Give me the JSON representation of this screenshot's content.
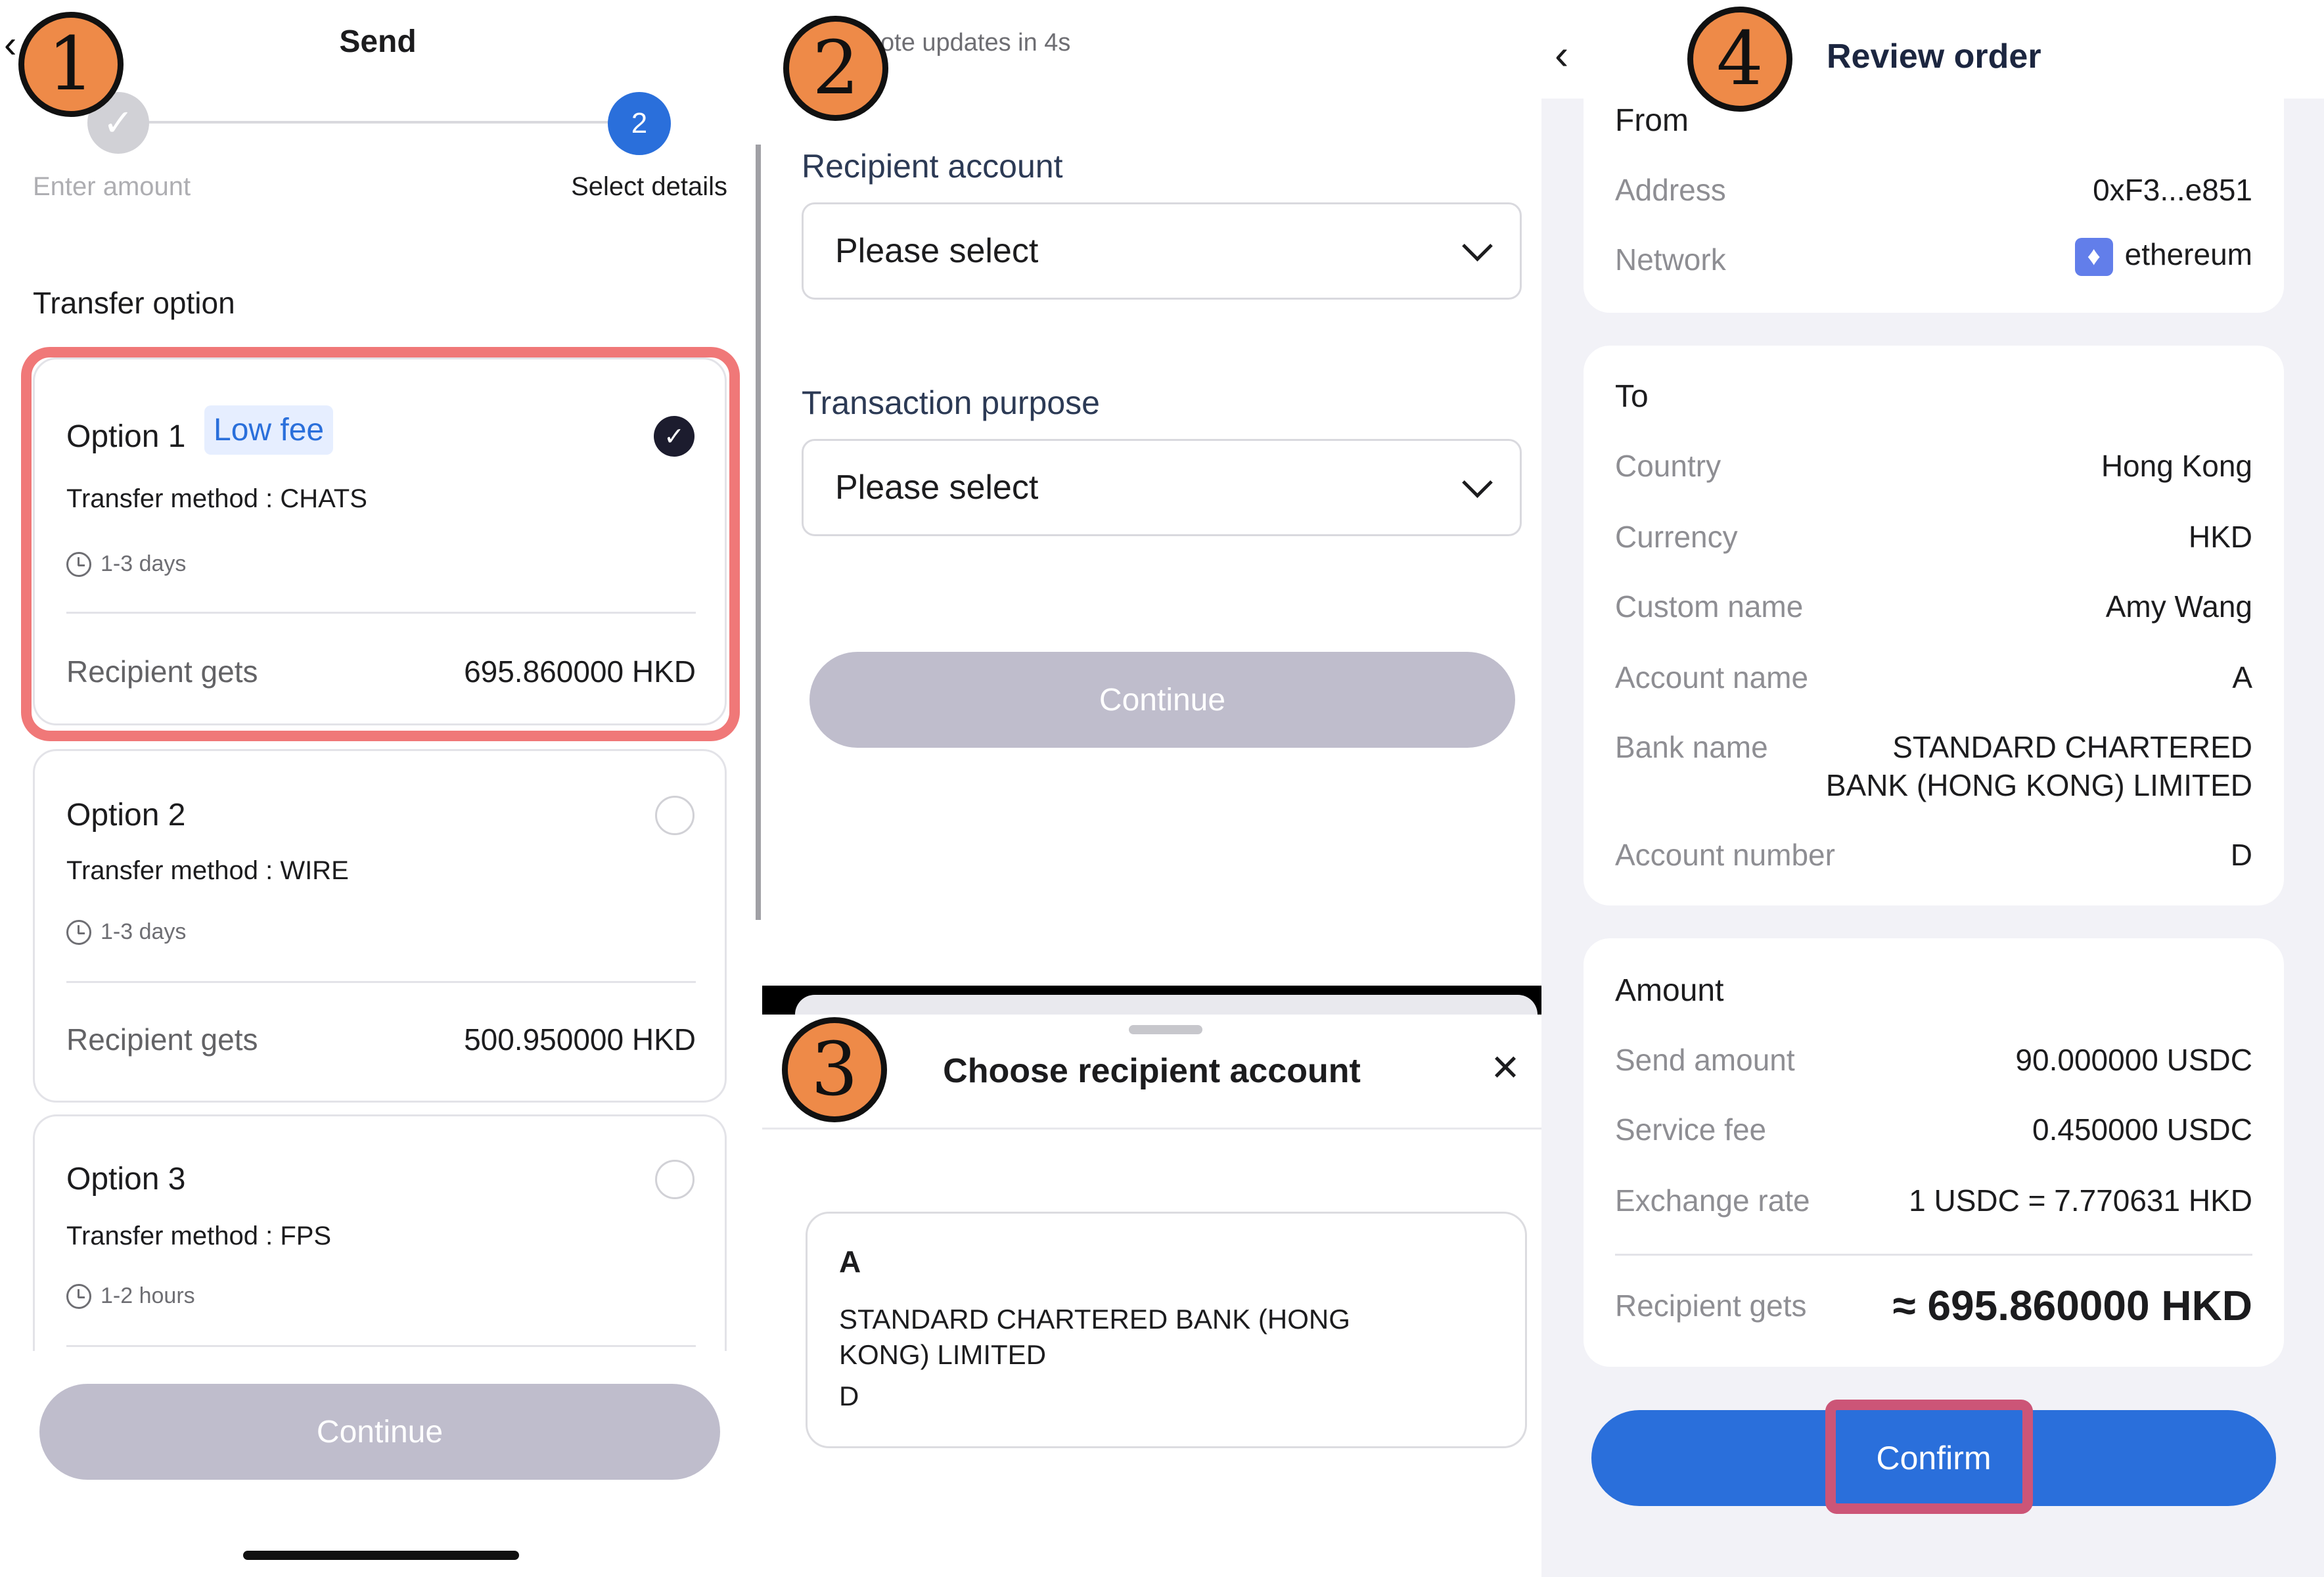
{
  "panel1": {
    "title": "Send",
    "back_icon": "‹",
    "step1_label": "Enter amount",
    "step2_number": "2",
    "step2_label": "Select details",
    "section_title": "Transfer option",
    "options": [
      {
        "name": "Option 1",
        "tag": "Low fee",
        "method": "Transfer method : CHATS",
        "time": "1-3 days",
        "gets_label": "Recipient gets",
        "gets_value": "695.860000 HKD"
      },
      {
        "name": "Option 2",
        "method": "Transfer method : WIRE",
        "time": "1-3 days",
        "gets_label": "Recipient gets",
        "gets_value": "500.950000 HKD"
      },
      {
        "name": "Option 3",
        "method": "Transfer method : FPS",
        "time": "1-2 hours"
      }
    ],
    "continue_label": "Continue"
  },
  "panel2": {
    "updates_text": "ote updates in 4s",
    "recipient_label": "Recipient account",
    "recipient_value": "Please select",
    "purpose_label": "Transaction purpose",
    "purpose_value": "Please select",
    "continue_label": "Continue"
  },
  "panel3": {
    "title": "Choose recipient account",
    "close_icon": "×",
    "account": {
      "name": "A",
      "bank": "STANDARD CHARTERED BANK (HONG KONG) LIMITED",
      "number": "D"
    }
  },
  "panel4": {
    "title": "Review order",
    "back_icon": "‹",
    "from": {
      "heading": "From",
      "address_label": "Address",
      "address_value": "0xF3...e851",
      "network_label": "Network",
      "network_value": "ethereum"
    },
    "to": {
      "heading": "To",
      "country_label": "Country",
      "country_value": "Hong Kong",
      "currency_label": "Currency",
      "currency_value": "HKD",
      "custom_label": "Custom name",
      "custom_value": "Amy Wang",
      "account_name_label": "Account name",
      "account_name_value": "A",
      "bank_label": "Bank name",
      "bank_value_line1": "STANDARD CHARTERED",
      "bank_value_line2": "BANK (HONG KONG) LIMITED",
      "account_number_label": "Account number",
      "account_number_value": "D"
    },
    "amount": {
      "heading": "Amount",
      "send_label": "Send amount",
      "send_value": "90.000000 USDC",
      "fee_label": "Service fee",
      "fee_value": "0.450000 USDC",
      "rate_label": "Exchange rate",
      "rate_value": "1 USDC = 7.770631 HKD",
      "gets_label": "Recipient gets",
      "gets_value": "≈ 695.860000 HKD"
    },
    "confirm_label": "Confirm"
  },
  "badges": [
    "1",
    "2",
    "3",
    "4"
  ],
  "colors": {
    "accent": "#2a6fdb",
    "badge": "#ee8a48",
    "highlight": "#f07878"
  }
}
